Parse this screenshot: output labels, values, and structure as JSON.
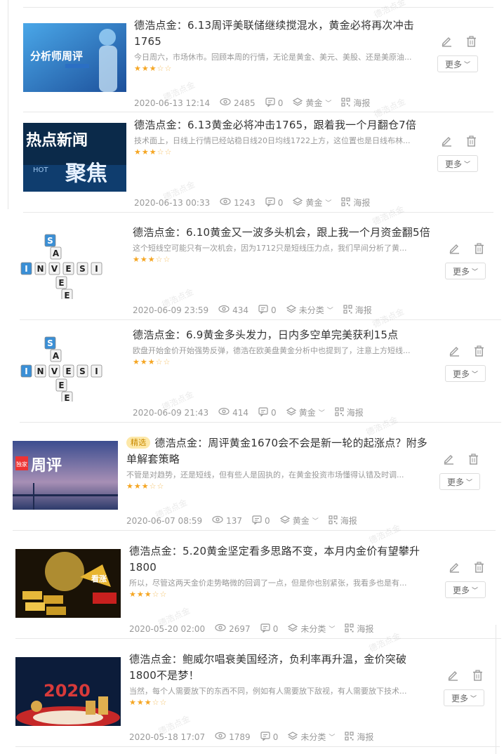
{
  "articles": [
    {
      "title": "德浩点金：6.13周评美联储继续搅混水，黄金必将再次冲击1765",
      "tag": "",
      "summary": "今日周六，市场休市。回顾本周的行情，无论是黄金、美元、美股、还是美原油...",
      "date": "2020-06-13 12:14",
      "views": "2485",
      "comments": "0",
      "category": "黄金",
      "poster": "海报",
      "more": "更多",
      "thumb": "analyst",
      "thumb_text": "分析师周评"
    },
    {
      "title": "德浩点金：6.13黄金必将冲击1765，跟着我一个月翻仓7倍",
      "tag": "",
      "summary": "技术面上，日线上行情已经站稳日线20日均线1722上方，这位置也是日线布林...",
      "date": "2020-06-13 00:33",
      "views": "1243",
      "comments": "0",
      "category": "黄金",
      "poster": "海报",
      "more": "更多",
      "thumb": "hotnews",
      "thumb_text": "热点新闻"
    },
    {
      "title": "德浩点金：6.10黄金又一波多头机会，跟上我一个月资金翻5倍",
      "tag": "",
      "summary": "这个短线空可能只有一次机会，因为1712只是短线压力点，我们早间分析了黄...",
      "date": "2020-06-09 23:59",
      "views": "434",
      "comments": "0",
      "category": "未分类",
      "poster": "海报",
      "more": "更多",
      "thumb": "invest",
      "thumb_text": ""
    },
    {
      "title": "德浩点金：6.9黄金多头发力，日内多空单完美获利15点",
      "tag": "",
      "summary": "欧盘开始金价开始强势反弹，德浩在欧美盘黄金分析中也提到了，注意上方短线...",
      "date": "2020-06-09 21:43",
      "views": "414",
      "comments": "0",
      "category": "黄金",
      "poster": "海报",
      "more": "更多",
      "thumb": "invest",
      "thumb_text": ""
    },
    {
      "title": "德浩点金：周评黄金1670会不会是新一轮的起涨点？附多单解套策略",
      "tag": "精选",
      "summary": "不管是对趋势，还是短线，但有些人是固执的，在黄金投资市场懂得认错及时调...",
      "date": "2020-06-07 08:59",
      "views": "137",
      "comments": "0",
      "category": "黄金",
      "poster": "海报",
      "more": "更多",
      "thumb": "weekly",
      "thumb_text": "周评"
    },
    {
      "title": "德浩点金：5.20黄金坚定看多思路不变，本月内金价有望攀升1800",
      "tag": "",
      "summary": "所以，尽管这两天金价走势略微的回调了一点，但是你也别紧张，我看多也是有...",
      "date": "2020-05-20 02:00",
      "views": "2697",
      "comments": "0",
      "category": "未分类",
      "poster": "海报",
      "more": "更多",
      "thumb": "gold",
      "thumb_text": "看涨"
    },
    {
      "title": "德浩点金：鲍威尔唱衰美国经济，负利率再升温，金价突破1800不是梦！",
      "tag": "",
      "summary": "当然，每个人需要放下的东西不同，例如有人需要放下敌视，有人需要放下技术...",
      "date": "2020-05-18 17:07",
      "views": "1789",
      "comments": "0",
      "category": "未分类",
      "poster": "海报",
      "more": "更多",
      "thumb": "y2020",
      "thumb_text": "2020"
    }
  ],
  "colors": {
    "star": "#f5a623",
    "tag_bg": "#fde8a8",
    "tag_text": "#c98a00",
    "meta": "#999999"
  },
  "icons": [
    "eye-icon",
    "comment-icon",
    "layers-icon",
    "qrcode-icon",
    "edit-icon",
    "trash-icon",
    "chevron-down-icon"
  ],
  "watermark": "德浩点金"
}
